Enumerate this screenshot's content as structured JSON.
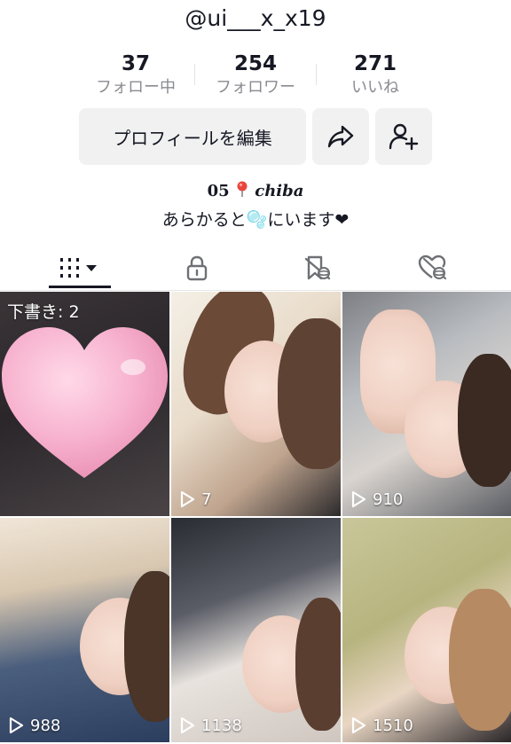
{
  "profile": {
    "username": "@ui___x_x19",
    "bio_line1_prefix": "05",
    "bio_pin_icon": "pin-icon",
    "bio_city": "chiba",
    "bio_line2": "あらかると🫧にいます❤"
  },
  "stats": [
    {
      "value": "37",
      "label": "フォロー中"
    },
    {
      "value": "254",
      "label": "フォロワー"
    },
    {
      "value": "271",
      "label": "いいね"
    }
  ],
  "actions": {
    "edit_profile_label": "プロフィールを編集",
    "share_icon": "share-icon",
    "add_friend_icon": "add-friend-icon"
  },
  "tabs": [
    {
      "icon": "videos-grid-icon",
      "selected": true
    },
    {
      "icon": "lock-icon",
      "selected": false
    },
    {
      "icon": "favorites-icon",
      "selected": false
    },
    {
      "icon": "liked-icon",
      "selected": false
    }
  ],
  "videos": [
    {
      "overlay": "下書き: 2",
      "views": ""
    },
    {
      "overlay": "",
      "views": "7"
    },
    {
      "overlay": "",
      "views": "910"
    },
    {
      "overlay": "",
      "views": "988"
    },
    {
      "overlay": "",
      "views": "1138"
    },
    {
      "overlay": "",
      "views": "1510"
    }
  ],
  "colors": {
    "text": "#161823",
    "secondary_text": "#8a8b91",
    "button_bg": "#f1f1f2",
    "heart_pink": "#f4a7c4"
  }
}
